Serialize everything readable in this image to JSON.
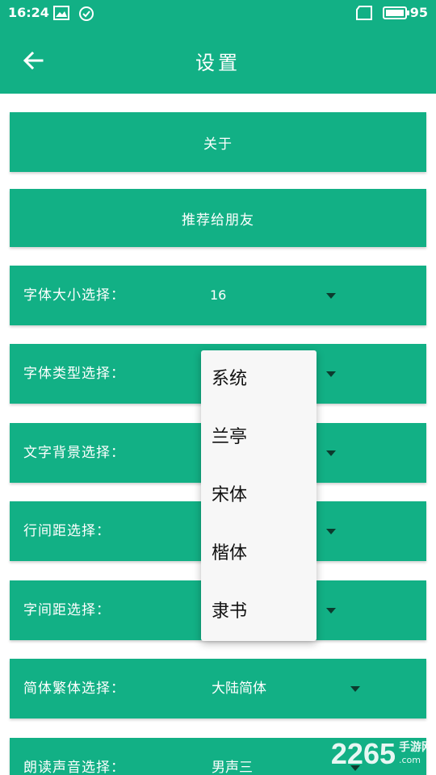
{
  "status_bar": {
    "time": "16:24",
    "battery": "95",
    "icons": [
      "image-icon",
      "check-circle-icon",
      "sim-icon",
      "battery-icon"
    ]
  },
  "app_bar": {
    "title": "设置",
    "back_icon": "arrow-left-icon"
  },
  "buttons": {
    "about": "关于",
    "recommend": "推荐给朋友"
  },
  "settings": [
    {
      "label": "字体大小选择：",
      "value": "16"
    },
    {
      "label": "字体类型选择：",
      "value": ""
    },
    {
      "label": "文字背景选择：",
      "value": ""
    },
    {
      "label": "行间距选择：",
      "value": ""
    },
    {
      "label": "字间距选择：",
      "value": ""
    },
    {
      "label": "简体繁体选择：",
      "value": "大陆简体"
    },
    {
      "label": "朗读声音选择：",
      "value": "男声三"
    }
  ],
  "dropdown": {
    "options": [
      "系统",
      "兰亭",
      "宋体",
      "楷体",
      "隶书"
    ]
  },
  "watermark": {
    "number": "2265",
    "cn": "手游网",
    "en": ".com"
  },
  "colors": {
    "primary": "#12b085",
    "caret": "#0c3b2e",
    "menu_bg": "#f7f7f7"
  }
}
